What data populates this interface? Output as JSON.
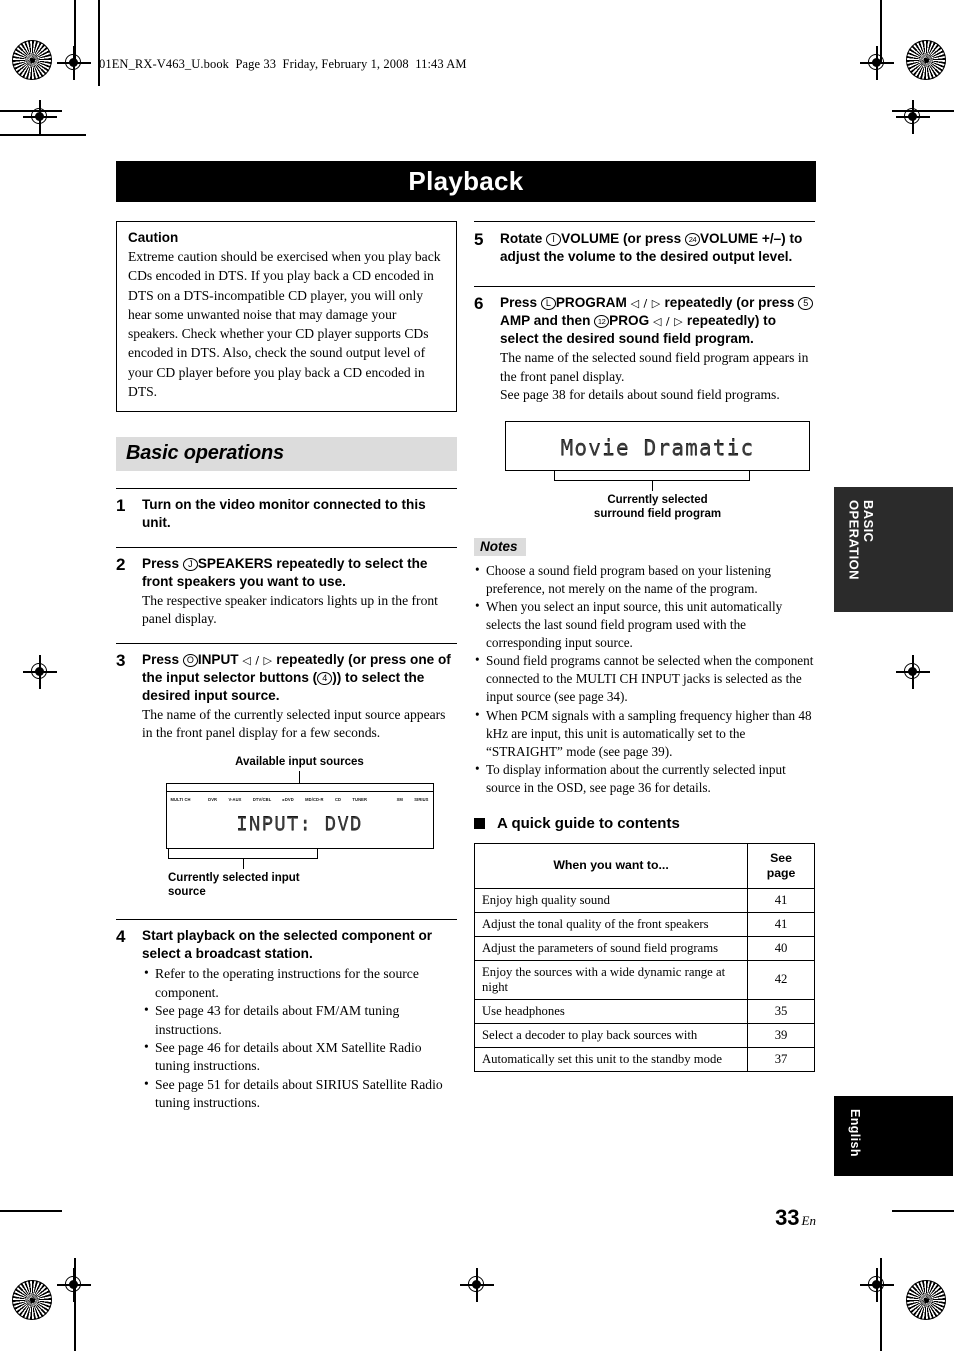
{
  "header": {
    "file_line": "01EN_RX-V463_U.book  Page 33  Friday, February 1, 2008  11:43 AM"
  },
  "title": "Playback",
  "caution": {
    "heading": "Caution",
    "body": "Extreme caution should be exercised when you play back CDs encoded in DTS. If you play back a CD encoded in DTS on a DTS-incompatible CD player, you will only hear some unwanted noise that may damage your speakers. Check whether your CD player supports CDs encoded in DTS. Also, check the sound output level of your CD player before you play back a CD encoded in DTS."
  },
  "section": {
    "basic_operations": "Basic operations"
  },
  "steps": {
    "step1": {
      "num": "1",
      "lead": "Turn on the video monitor connected to this unit."
    },
    "step2": {
      "num": "2",
      "lead_pre": "Press ",
      "circle": "J",
      "lead_post": "SPEAKERS repeatedly to select the front speakers you want to use.",
      "sub": "The respective speaker indicators lights up in the front panel display."
    },
    "step3": {
      "num": "3",
      "lead_pre": "Press ",
      "circle": "O",
      "lead_mid": "INPUT ",
      "arrows": "◁ / ▷",
      "lead_mid2": " repeatedly (or press one of the input selector buttons (",
      "circle2": "4",
      "lead_post": ")) to select the desired input source.",
      "sub": "The name of the currently selected input source appears in the front panel display for a few seconds."
    },
    "step4": {
      "num": "4",
      "lead": "Start playback on the selected component or select a broadcast station.",
      "bullets": [
        "Refer to the operating instructions for the source component.",
        "See page 43 for details about FM/AM tuning instructions.",
        "See page 46 for details about XM Satellite Radio tuning instructions.",
        "See page 51 for details about SIRIUS Satellite Radio tuning instructions."
      ]
    },
    "step5": {
      "num": "5",
      "lead_pre": "Rotate ",
      "circle": "I",
      "lead_mid": "VOLUME (or press ",
      "circle2": "24",
      "lead_post": "VOLUME +/–) to adjust the volume to the desired output level."
    },
    "step6": {
      "num": "6",
      "lead_pre": "Press ",
      "circle": "L",
      "lead_a": "PROGRAM ",
      "arrows1": "◁ / ▷",
      "lead_b": " repeatedly (or press ",
      "circle2": "5",
      "lead_c": "AMP and then ",
      "circle3": "12",
      "lead_d": "PROG ",
      "arrows2": "◁ / ▷",
      "lead_e": " repeatedly) to select the desired sound field program.",
      "sub1": "The name of the selected sound field program appears in the front panel display.",
      "sub2": "See page 38 for details about sound field programs."
    }
  },
  "figure_input": {
    "caption_top": "Available input sources",
    "sources": [
      "MULTI CH",
      "DVR",
      "V-AUX",
      "DTV/CBL",
      "▸DVD",
      "MD/CD-R",
      "CD",
      "TUNER",
      "XM",
      "SIRIUS"
    ],
    "display_text": "INPUT: DVD",
    "caption_bottom_line1": "Currently selected input",
    "caption_bottom_line2": "source"
  },
  "figure_program": {
    "display_text": "Movie Dramatic",
    "caption_line1": "Currently selected",
    "caption_line2": "surround field program"
  },
  "notes": {
    "heading": "Notes",
    "items": [
      "Choose a sound field program based on your listening preference, not merely on the name of the program.",
      "When you select an input source, this unit automatically selects the last sound field program used with the corresponding input source.",
      "Sound field programs cannot be selected when the component connected to the MULTI CH INPUT jacks is selected as the input source (see page 34).",
      "When PCM signals with a sampling frequency higher than 48 kHz are input, this unit is automatically set to the “STRAIGHT” mode (see page 39).",
      "To display information about the currently selected input source in the OSD, see page 36 for details."
    ]
  },
  "quick_guide": {
    "heading": "A quick guide to contents",
    "columns": [
      "When you want to...",
      "See\npage"
    ],
    "col_want": "When you want to...",
    "col_page_line1": "See",
    "col_page_line2": "page",
    "rows": [
      {
        "want": "Enjoy high quality sound",
        "page": "41"
      },
      {
        "want": "Adjust the tonal quality of the front speakers",
        "page": "41"
      },
      {
        "want": "Adjust the parameters of sound field programs",
        "page": "40"
      },
      {
        "want": "Enjoy the sources with a wide dynamic range at night",
        "page": "42"
      },
      {
        "want": "Use headphones",
        "page": "35"
      },
      {
        "want": "Select a decoder to play back sources with",
        "page": "39"
      },
      {
        "want": "Automatically set this unit to the standby mode",
        "page": "37"
      }
    ]
  },
  "side_tabs": {
    "basic_operation": "BASIC\nOPERATION",
    "basic_line1": "BASIC",
    "basic_line2": "OPERATION",
    "language": "English"
  },
  "page_number": {
    "number": "33",
    "suffix": "En"
  },
  "colors": {
    "banner_bg": "#000000",
    "section_bg": "#dcdcdc",
    "tab_bg": "#2b2b2b",
    "lcd_text": "#3a3a3a"
  }
}
